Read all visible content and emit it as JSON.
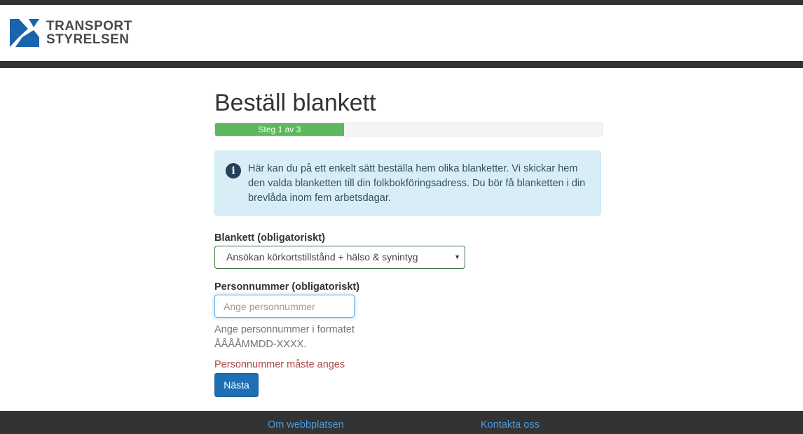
{
  "header": {
    "logo_line1": "TRANSPORT",
    "logo_line2": "STYRELSEN",
    "logo_icon": "transportstyrelsen-logo-icon",
    "brand_colors": {
      "logo_blue": "#1a63ad",
      "dark_bar": "#333333"
    }
  },
  "main": {
    "title": "Beställ blankett",
    "progress": {
      "label": "Steg 1 av 3",
      "fraction": 0.333,
      "color": "#5cb85c"
    },
    "info": {
      "icon": "info-icon",
      "text": "Här kan du på ett enkelt sätt beställa hem olika blanketter. Vi skickar hem den valda blanketten till din folkbokföringsadress. Du bör få blanketten i din brevlåda inom fem arbetsdagar."
    },
    "blankett": {
      "label": "Blankett (obligatoriskt)",
      "selected": "Ansökan körkortstillstånd + hälso & synintyg",
      "arrow_icon": "dropdown-arrow-icon"
    },
    "personnummer": {
      "label": "Personnummer (obligatoriskt)",
      "value": "",
      "placeholder": "Ange personnummer",
      "help_line1": "Ange personnummer i formatet",
      "help_line2": "ÅÅÅÅMMDD-XXXX.",
      "error": "Personnummer måste anges"
    },
    "next_button": "Nästa"
  },
  "footer": {
    "links": [
      "Om webbplatsen",
      "Kontakta oss"
    ]
  }
}
